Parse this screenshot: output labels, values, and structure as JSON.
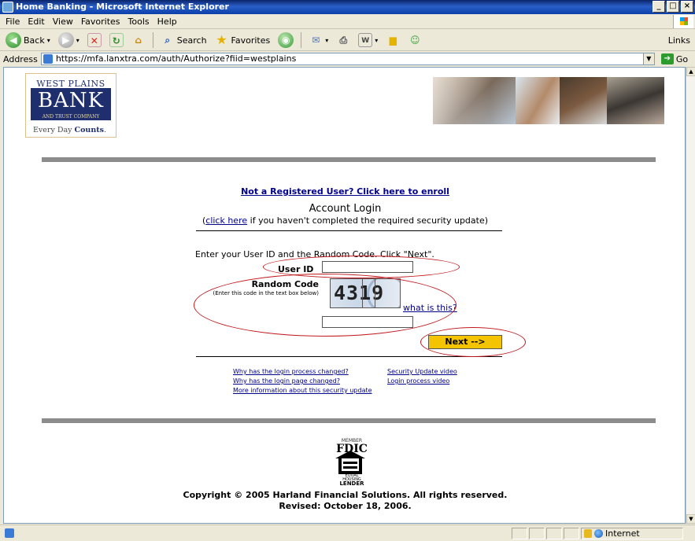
{
  "window": {
    "title": "Home Banking - Microsoft Internet Explorer",
    "controls": [
      "_",
      "□",
      "×"
    ]
  },
  "menu": [
    "File",
    "Edit",
    "View",
    "Favorites",
    "Tools",
    "Help"
  ],
  "toolbar": {
    "back": "Back",
    "search": "Search",
    "favorites": "Favorites",
    "links": "Links"
  },
  "address": {
    "label": "Address",
    "url": "https://mfa.lanxtra.com/auth/Authorize?fiid=westplains",
    "go": "Go"
  },
  "bank": {
    "name_top": "WEST PLAINS",
    "name_big": "BANK",
    "name_sub": "AND TRUST COMPANY",
    "tagline_prefix": "Every Day ",
    "tagline_bold": "Counts"
  },
  "login": {
    "enroll_link": "Not a Registered User? Click here to enroll",
    "title": "Account Login",
    "note_open": "(",
    "note_link": "click here",
    "note_rest": " if you haven't completed the required security update)",
    "instructions": "Enter your User ID and the Random Code. Click \"Next\".",
    "user_id_label": "User ID",
    "random_code_label": "Random Code",
    "random_code_hint": "(Enter this code in the text box below)",
    "captcha_text": "4319",
    "what_is_this": "what is this?",
    "next_button": "Next -->"
  },
  "help_links": {
    "login_process_changed": "Why has the login process changed?",
    "login_page_changed": "Why has the login page changed?",
    "more_info": "More information about this security update",
    "security_video": "Security Update video",
    "login_video": "Login process video"
  },
  "footer": {
    "fdic_member": "MEMBER",
    "fdic": "FDIC",
    "ehl_text": "EQUAL HOUSING",
    "ehl_lender": "LENDER",
    "copyright": "Copyright © 2005 Harland Financial Solutions.  All rights reserved.",
    "revised": "Revised: October 18, 2006."
  },
  "status": {
    "zone": "Internet"
  },
  "colors": {
    "titlebar": "#0a246a",
    "bank_navy": "#1f2f6e",
    "link": "#00008b",
    "next_button": "#f5c400",
    "annotation_ring": "#c0181c"
  }
}
